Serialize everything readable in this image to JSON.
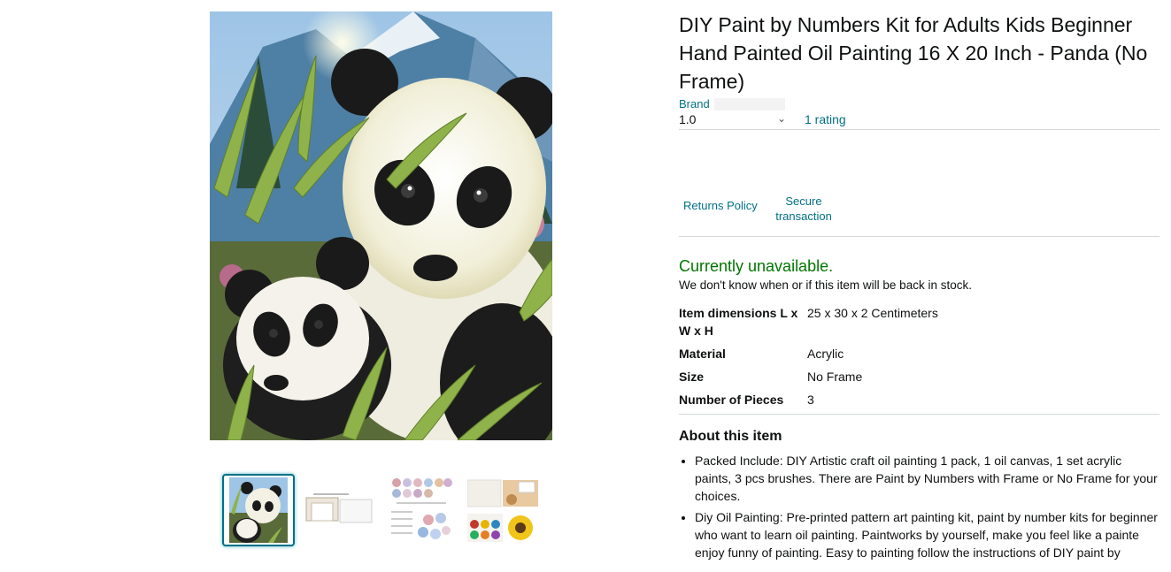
{
  "product": {
    "title": "DIY Paint by Numbers Kit for Adults Kids Beginner Hand Painted Oil Painting 16 X 20 Inch - Panda (No Frame)",
    "brand_label": "Brand",
    "rating_value": "1.0",
    "rating_count_label": "1 rating"
  },
  "policies": {
    "returns_label": "Returns Policy",
    "secure_label": "Secure transaction"
  },
  "availability": {
    "status": "Currently unavailable.",
    "note": "We don't know when or if this item will be back in stock."
  },
  "specs": [
    {
      "key": "Item dimensions L x W x H",
      "value": "25 x 30 x 2 Centimeters"
    },
    {
      "key": "Material",
      "value": "Acrylic"
    },
    {
      "key": "Size",
      "value": "No Frame"
    },
    {
      "key": "Number of Pieces",
      "value": "3"
    }
  ],
  "about": {
    "title": "About this item",
    "bullets": [
      "Packed Include: DIY Artistic craft oil painting 1 pack, 1 oil canvas, 1 set acrylic paints, 3 pcs brushes. There are Paint by Numbers with Frame or No Frame for your choices.",
      "Diy Oil Painting: Pre-printed pattern art painting kit, paint by number kits for beginner who want to learn oil painting. Paintworks by yourself, make you feel like a painte enjoy funny of painting. Easy to painting follow the instructions of DIY paint by"
    ]
  },
  "colors": {
    "link": "#007185",
    "available_green": "#007600",
    "divider": "#d5d9d9",
    "thumb_selected": "#007185"
  },
  "icons": {
    "rating_dropdown": "chevron-down-icon"
  }
}
